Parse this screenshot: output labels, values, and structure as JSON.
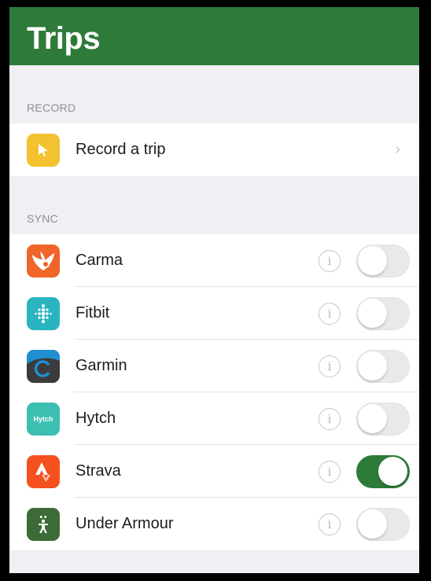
{
  "header": {
    "title": "Trips"
  },
  "record_section": {
    "label": "RECORD",
    "items": [
      {
        "label": "Record a trip",
        "icon": "cursor-arrow-icon",
        "icon_color": "#f2c230",
        "chevron": "›"
      }
    ]
  },
  "sync_section": {
    "label": "SYNC",
    "items": [
      {
        "label": "Carma",
        "icon": "carma-icon",
        "icon_color": "#f0652a",
        "enabled": false
      },
      {
        "label": "Fitbit",
        "icon": "fitbit-icon",
        "icon_color": "#2ab4c0",
        "enabled": false
      },
      {
        "label": "Garmin",
        "icon": "garmin-icon",
        "icon_color": "#3b3b3b",
        "enabled": false
      },
      {
        "label": "Hytch",
        "icon": "hytch-icon",
        "icon_color": "#3cbfb0",
        "enabled": false,
        "icon_text": "Hytch"
      },
      {
        "label": "Strava",
        "icon": "strava-icon",
        "icon_color": "#f4511e",
        "enabled": true
      },
      {
        "label": "Under Armour",
        "icon": "under-armour-icon",
        "icon_color": "#3d6b37",
        "enabled": false
      }
    ],
    "info_glyph": "i"
  },
  "colors": {
    "header_bg": "#2e7b39",
    "toggle_on": "#2e7b39",
    "background": "#efeff4"
  }
}
